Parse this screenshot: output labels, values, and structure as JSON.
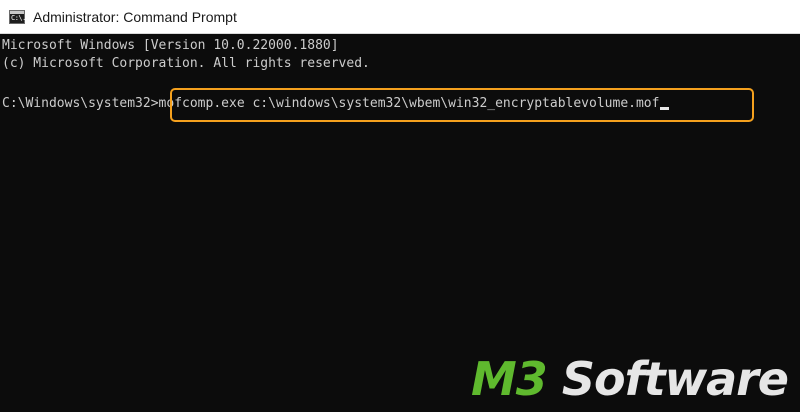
{
  "window": {
    "title": "Administrator: Command Prompt",
    "icon": "command-prompt-icon",
    "icon_glyph": "C:\\."
  },
  "console": {
    "line1": "Microsoft Windows [Version 10.0.22000.1880]",
    "line2": "(c) Microsoft Corporation. All rights reserved.",
    "prompt": "C:\\Windows\\system32>",
    "command": "mofcomp.exe c:\\windows\\system32\\wbem\\win32_encryptablevolume.mof"
  },
  "highlight": {
    "color": "#f5a11e"
  },
  "watermark": {
    "part1": "M3",
    "part2": " Software",
    "color_primary": "#5fb92e",
    "color_secondary": "#e6e6e6"
  }
}
